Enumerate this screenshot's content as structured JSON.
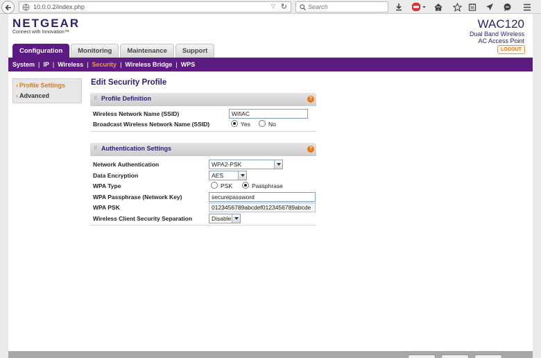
{
  "browser": {
    "url": "10.0.0.2/index.php",
    "search_placeholder": "Search"
  },
  "header": {
    "logo": "NETGEAR",
    "tagline": "Connect with Innovation™",
    "model": "WAC120",
    "model_sub1": "Dual Band Wireless",
    "model_sub2": "AC Access Point",
    "logout": "LOGOUT"
  },
  "tabs": [
    {
      "label": "Configuration"
    },
    {
      "label": "Monitoring"
    },
    {
      "label": "Maintenance"
    },
    {
      "label": "Support"
    }
  ],
  "subnav": [
    {
      "label": "System"
    },
    {
      "label": "IP"
    },
    {
      "label": "Wireless"
    },
    {
      "label": "Security"
    },
    {
      "label": "Wireless Bridge"
    },
    {
      "label": "WPS"
    }
  ],
  "sidebar": [
    {
      "label": "Profile Settings"
    },
    {
      "label": "Advanced"
    }
  ],
  "content": {
    "title": "Edit Security Profile",
    "profile": {
      "heading": "Profile Definition",
      "ssid_label": "Wireless Network Name (SSID)",
      "ssid_value": "WifiAC",
      "broadcast_label": "Broadcast Wireless Network Name (SSID)",
      "yes": "Yes",
      "no": "No"
    },
    "auth": {
      "heading": "Authentication Settings",
      "net_auth_label": "Network Authentication",
      "net_auth_value": "WPA2-PSK",
      "encryption_label": "Data Encryption",
      "encryption_value": "AES",
      "wpa_type_label": "WPA Type",
      "psk": "PSK",
      "passphrase": "Passphrase",
      "passphrase_label": "WPA Passphrase (Network Key)",
      "passphrase_value": "securepassword",
      "psk_label": "WPA PSK",
      "psk_value": "0123456789abcdef0123456789abcde",
      "separation_label": "Wireless Client Security Separation",
      "separation_value": "Disable"
    }
  },
  "colors": {
    "brand_purple": "#5b1b83",
    "accent_orange": "#e67817"
  }
}
